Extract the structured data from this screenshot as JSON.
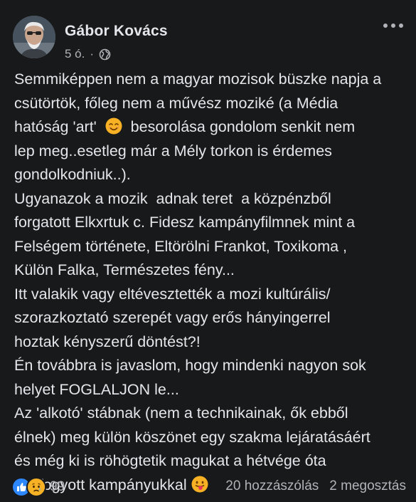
{
  "post": {
    "author": "Gábor Kovács",
    "time": "5 ó.",
    "separator": "·",
    "privacy_icon": "globe-icon",
    "lines": [
      [
        "Semmiképpen nem a magyar mozisok büszke napja a"
      ],
      [
        "csütörtök, főleg nem a művész moziké (a Média"
      ],
      [
        "hatóság 'art'  ",
        "smiling-face-emoji",
        "  besorolása gondolom senkit nem"
      ],
      [
        "lep meg..esetleg már a Mély torkon is érdemes"
      ],
      [
        "gondolkodniuk..)."
      ],
      [
        "Ugyanazok a mozik  adnak teret  a közpénzből"
      ],
      [
        "forgatott Elkxrtuk c. Fidesz kampányfilmnek mint a"
      ],
      [
        "Felségem története, Eltörölni Frankot, Toxikoma ,"
      ],
      [
        "Külön Falka, Természetes fény..."
      ],
      [
        "Itt valakik vagy eltévesztették a mozi kultúrális/"
      ],
      [
        "szorazkoztató szerepét vagy erős hányingerrel"
      ],
      [
        "hoztak kényszerű döntést?!"
      ],
      [
        "Én továbbra is javaslom, hogy mindenki nagyon sok"
      ],
      [
        "helyet FOGLALJON le..."
      ],
      [
        "Az 'alkotó' stábnak (nem a technikainak, ők ebből"
      ],
      [
        "élnek) meg külön köszönet egy szakma lejáratásáért"
      ],
      [
        "és még ki is röhögtetik magukat a hétvége óta"
      ],
      [
        "okafogyott kampányukkal ",
        "tongue-out-emoji"
      ]
    ]
  },
  "footer": {
    "reaction_icons": [
      "like-icon",
      "sad-icon"
    ],
    "reaction_count": "99",
    "comments": "20 hozzászólás",
    "shares": "2 megosztás"
  },
  "colors": {
    "background": "#18191a",
    "text": "#e4e6eb",
    "secondary": "#b0b3b8",
    "like": "#2d88ff",
    "emoji": "#f7b125"
  }
}
